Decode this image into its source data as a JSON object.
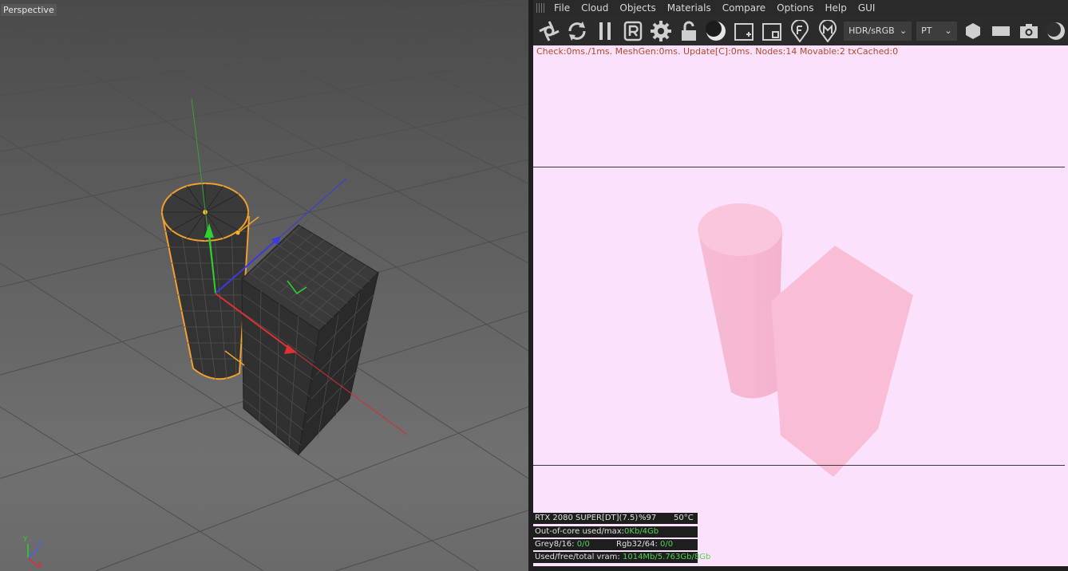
{
  "viewport": {
    "label": "Perspective",
    "axis_labels": {
      "y": "Y",
      "z": "Z",
      "x": "X"
    }
  },
  "renderer": {
    "menu": [
      "File",
      "Cloud",
      "Objects",
      "Materials",
      "Compare",
      "Options",
      "Help",
      "GUI"
    ],
    "color_mode": "HDR/sRGB",
    "kernel": "PT",
    "stats_line": "Check:0ms./1ms. MeshGen:0ms. Update[C]:0ms. Nodes:14 Movable:2 txCached:0",
    "gpu": {
      "name": "RTX 2080 SUPER[DT](7.5)",
      "usage": "%97",
      "temp": "50°C"
    },
    "out_of_core": {
      "label": "Out-of-core used/max:",
      "value": "0Kb/4Gb"
    },
    "grey": {
      "label": "Grey8/16:",
      "value": "0/0"
    },
    "rgb": {
      "label": "Rgb32/64:",
      "value": "0/0"
    },
    "vram": {
      "label": "Used/free/total vram:",
      "value": "1014Mb/5.763Gb/8Gb"
    }
  },
  "colors": {
    "viewport_bg": "#5c5c5c",
    "render_bg": "#fbe1fb",
    "render_object": "#f9bdd6",
    "selection_outline": "#f0a030",
    "stats_text": "#b34a2a",
    "status_value": "#57d057"
  }
}
